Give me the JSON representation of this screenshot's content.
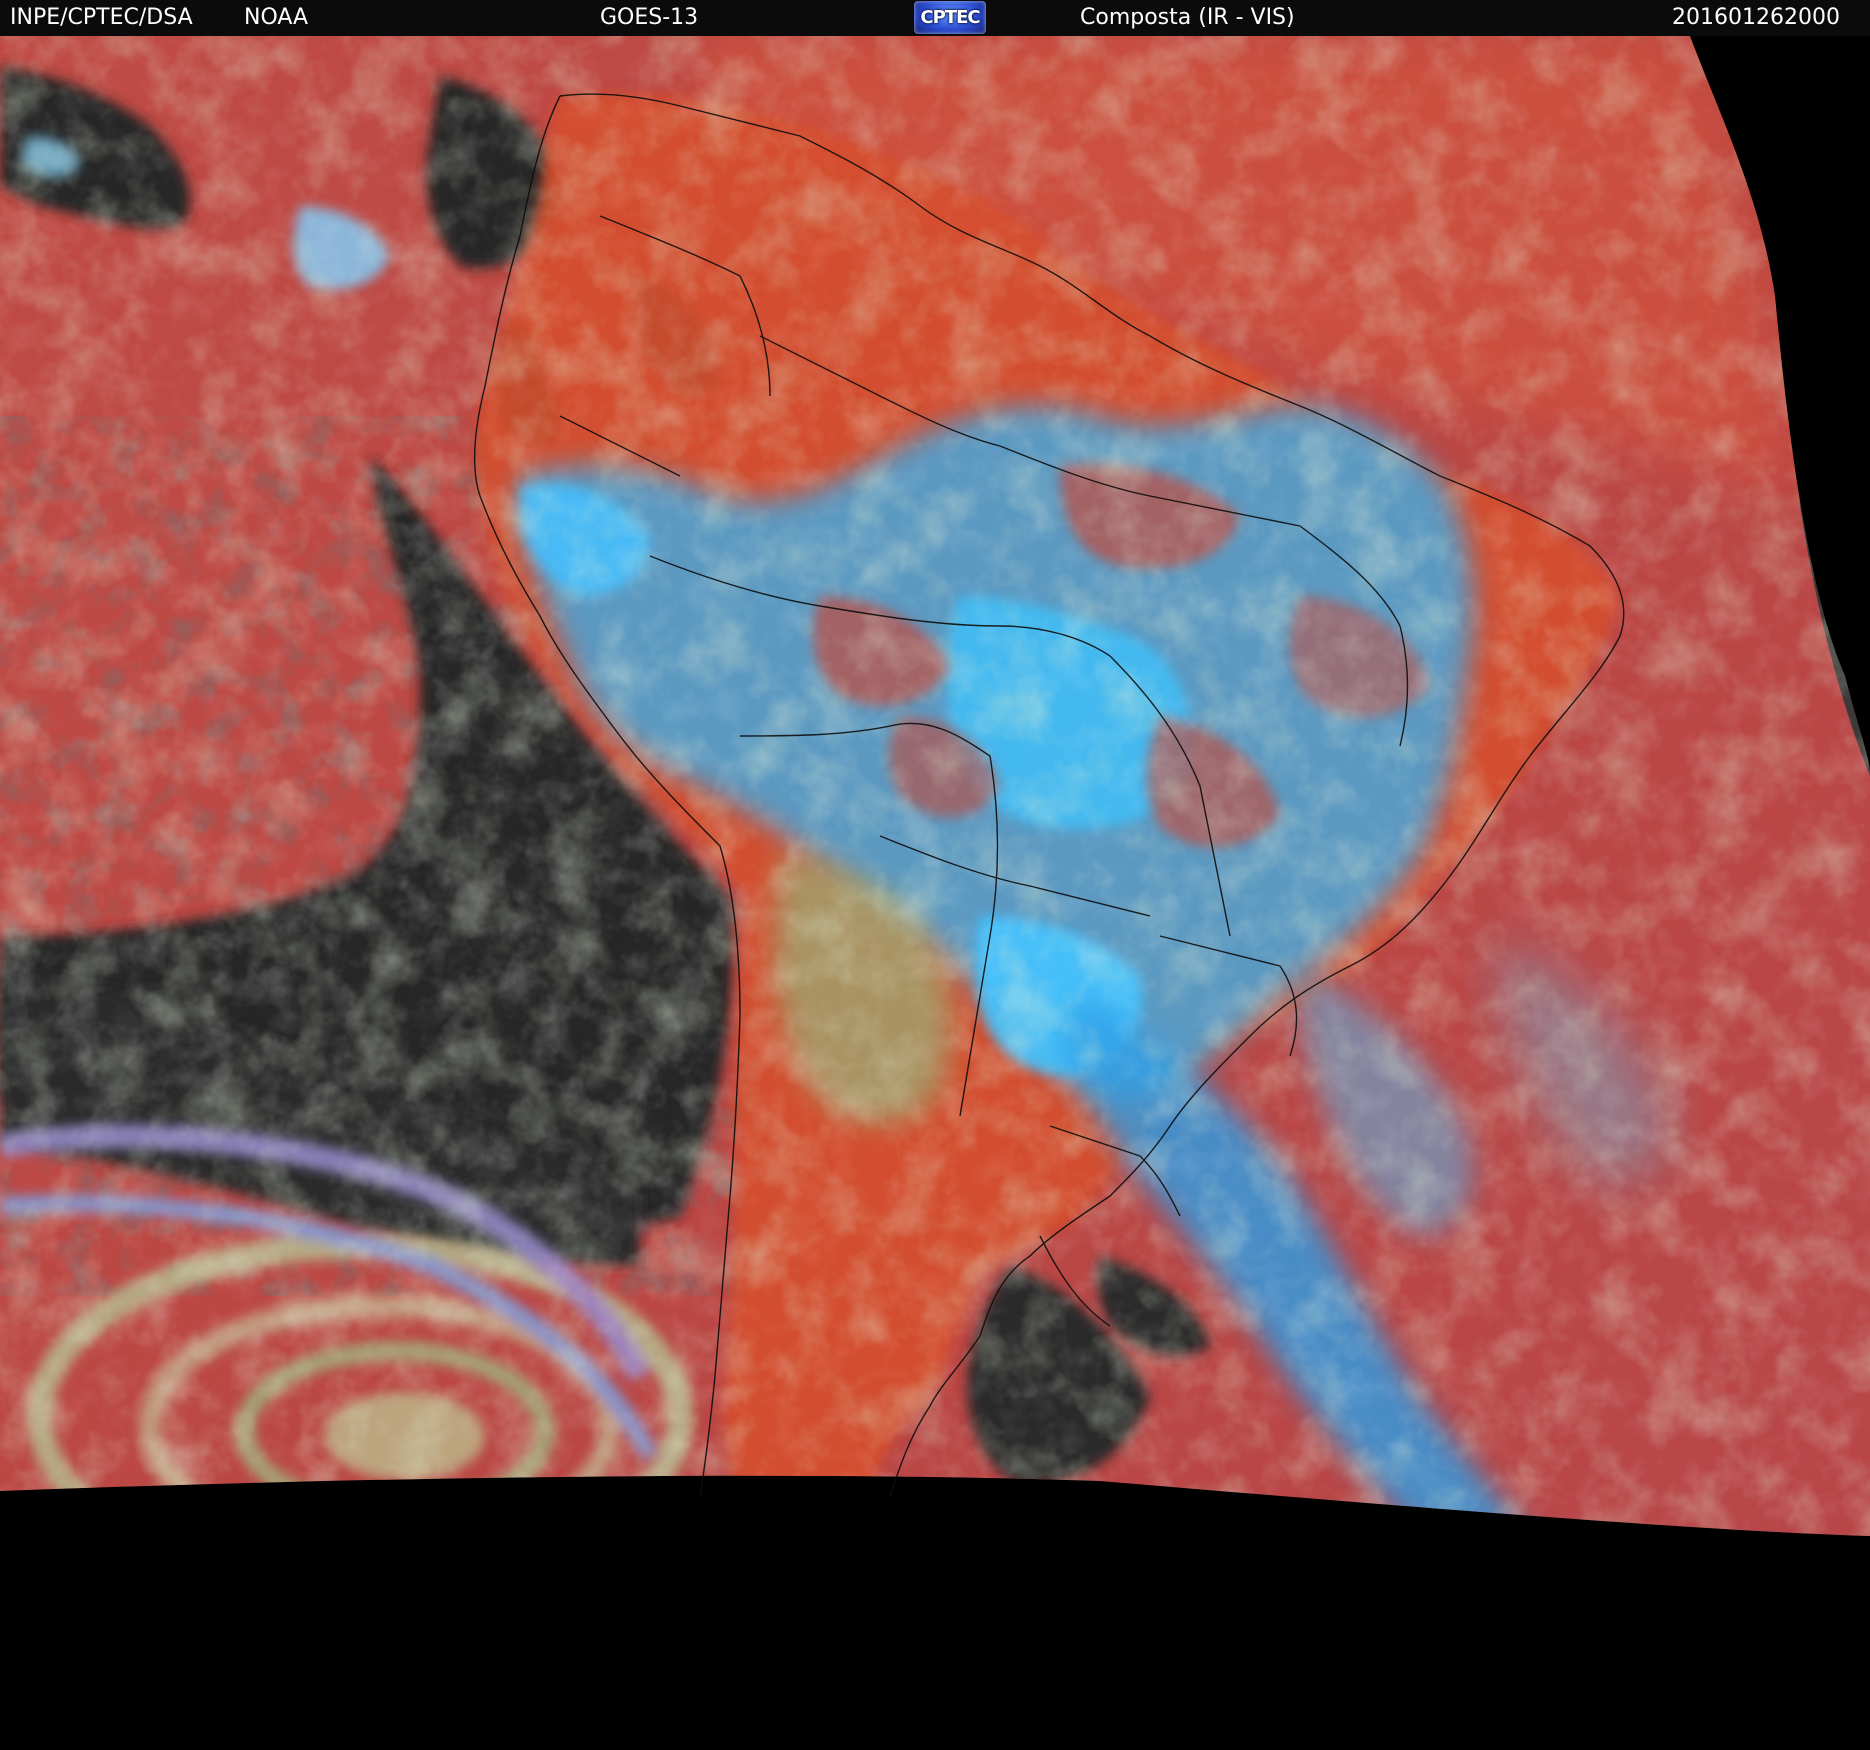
{
  "header": {
    "org": "INPE/CPTEC/DSA",
    "agency": "NOAA",
    "satellite": "GOES-13",
    "logo": "CPTEC",
    "product": "Composta (IR - VIS)",
    "timestamp": "201601262000"
  },
  "colors": {
    "background": "#000000",
    "ocean_clear": "#2b2b2b",
    "warm_surface": "#b84a48",
    "land_warm": "#e0552a",
    "high_cloud_cold": "#2fb5ff",
    "mid_cloud": "#8fb57a",
    "low_cloud": "#c8a98e",
    "borders": "#111111"
  }
}
